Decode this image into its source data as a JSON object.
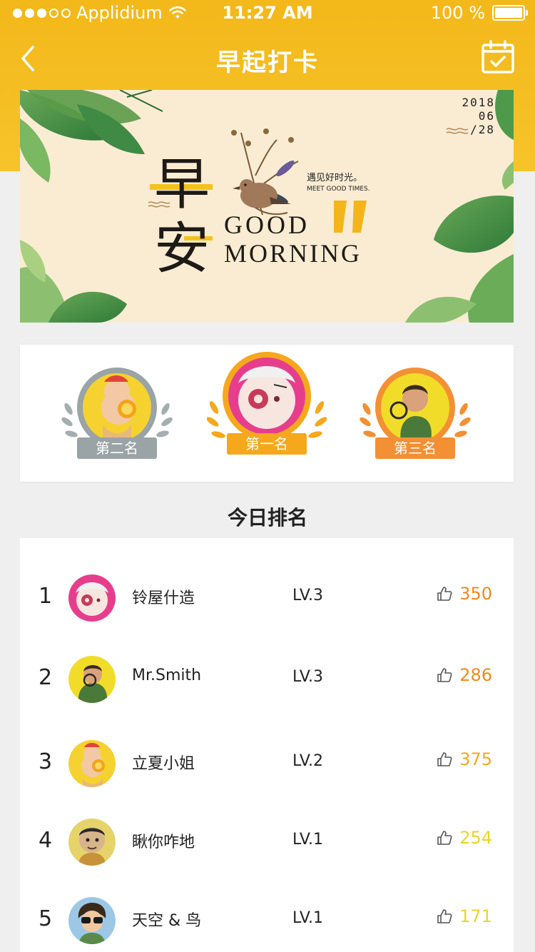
{
  "status_bar": {
    "carrier": "Applidium",
    "time": "11:27 AM",
    "battery": "100 %"
  },
  "nav": {
    "title": "早起打卡",
    "back_icon": "chevron-left-icon",
    "calendar_icon": "calendar-check-icon"
  },
  "banner": {
    "title_char_1": "早",
    "title_char_2": "安",
    "good": "GOOD",
    "morning": "MORNING",
    "tagline_cn": "遇见好时光。",
    "tagline_en": "MEET GOOD TIMES.",
    "date_year": "2018",
    "date_month": "06",
    "date_day": "/28"
  },
  "podium": [
    {
      "rank_label": "第二名",
      "color": "#9aa3a6"
    },
    {
      "rank_label": "第一名",
      "color": "#f5a81c"
    },
    {
      "rank_label": "第三名",
      "color": "#f39033"
    }
  ],
  "ranking": {
    "title": "今日排名",
    "rows": [
      {
        "rank": "1",
        "name": "铃屋什造",
        "level": "LV.3",
        "likes": "350",
        "color": "#f08a1c"
      },
      {
        "rank": "2",
        "name": "Mr.Smith",
        "level": "LV.3",
        "likes": "286",
        "color": "#f08a1c"
      },
      {
        "rank": "3",
        "name": "立夏小姐",
        "level": "LV.2",
        "likes": "375",
        "color": "#f5a81c"
      },
      {
        "rank": "4",
        "name": "瞅你咋地",
        "level": "LV.1",
        "likes": "254",
        "color": "#e8d62a"
      },
      {
        "rank": "5",
        "name": "天空 & 鸟",
        "level": "LV.1",
        "likes": "171",
        "color": "#e8d62a"
      }
    ]
  }
}
